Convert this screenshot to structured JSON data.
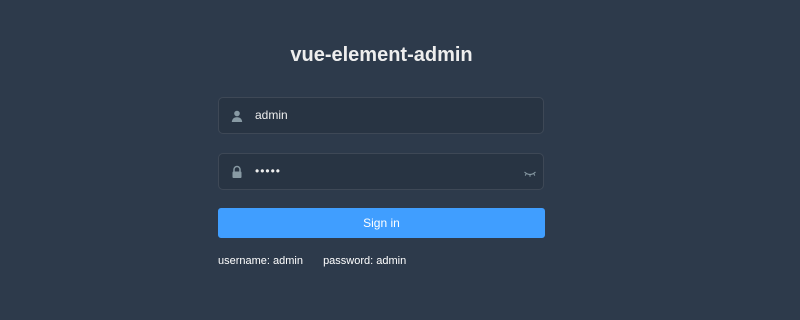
{
  "app": {
    "title": "vue-element-admin"
  },
  "form": {
    "username": {
      "value": "admin",
      "icon": "user-icon"
    },
    "password": {
      "value": "•••••",
      "icon": "lock-icon",
      "toggle_icon": "eye-closed-icon"
    },
    "submit_label": "Sign in"
  },
  "tips": {
    "username": "username: admin",
    "password": "password: admin"
  },
  "colors": {
    "background": "#2d3a4b",
    "accent": "#409eff",
    "text": "#eeeeee"
  }
}
